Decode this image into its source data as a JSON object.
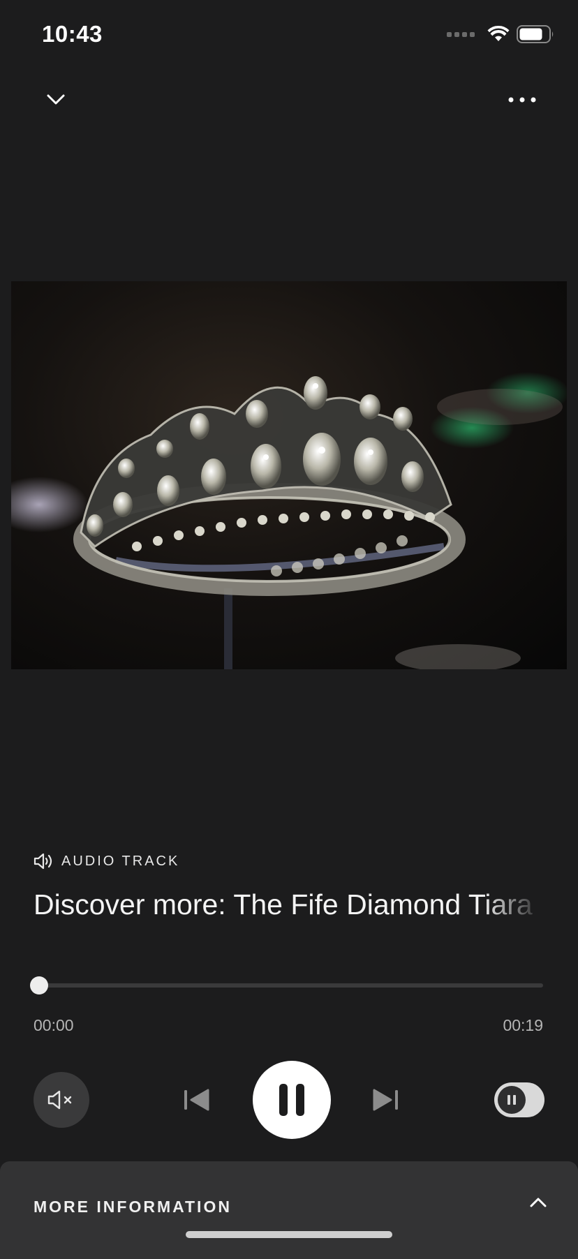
{
  "status_bar": {
    "time": "10:43",
    "battery_level": 0.8
  },
  "header": {
    "collapse_icon": "chevron-down-icon",
    "more_icon": "more-horizontal-icon"
  },
  "artwork": {
    "subject": "diamond-tiara-photo"
  },
  "track": {
    "type_icon": "speaker-icon",
    "type_label": "AUDIO TRACK",
    "title": "Discover more: The Fife Diamond Tiara"
  },
  "player": {
    "elapsed": "00:00",
    "duration": "00:19",
    "progress": 0.0,
    "is_playing": true,
    "muted": true,
    "icons": {
      "mute": "speaker-muted-icon",
      "previous": "skip-previous-icon",
      "play_pause": "pause-icon",
      "next": "skip-next-icon",
      "toggle": "pause-toggle-icon"
    }
  },
  "info_panel": {
    "label": "MORE INFORMATION",
    "icon": "chevron-up-icon"
  },
  "colors": {
    "background": "#1c1c1d",
    "panel": "#333334",
    "accent": "#ffffff",
    "muted_text": "#b5b5b5"
  }
}
